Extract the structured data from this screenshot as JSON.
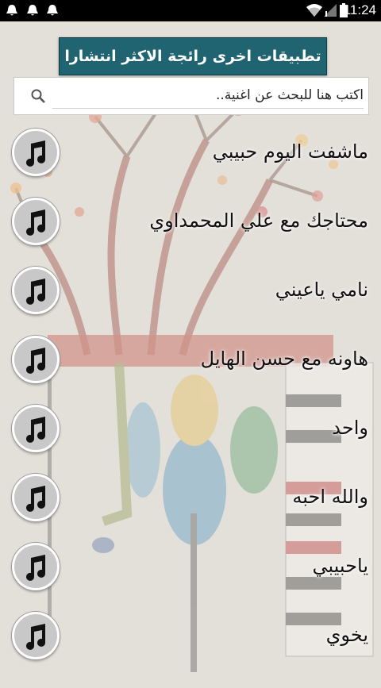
{
  "status_bar": {
    "time": "11:24",
    "notification_icons": [
      "notification-icon",
      "notification-icon",
      "notification-icon"
    ],
    "system_icons": [
      "wifi-icon",
      "signal-icon",
      "battery-icon"
    ]
  },
  "promo_button": {
    "label": "تطبيقات اخرى رائجة الاكثر انتشارا"
  },
  "search": {
    "placeholder": "اكتب هنا للبحث عن اغنية..",
    "value": ""
  },
  "songs": [
    {
      "title": "ماشفت اليوم حبيبي",
      "icon": "music-note-icon"
    },
    {
      "title": "محتاجك مع علي المحمداوي",
      "icon": "music-note-icon"
    },
    {
      "title": "نامي ياعيني",
      "icon": "music-note-icon"
    },
    {
      "title": "هاونه مع حسن الهايل",
      "icon": "music-note-icon"
    },
    {
      "title": "واحد",
      "icon": "music-note-icon"
    },
    {
      "title": "والله احبه",
      "icon": "music-note-icon"
    },
    {
      "title": "ياحبيبي",
      "icon": "music-note-icon"
    },
    {
      "title": "يخوي",
      "icon": "music-note-icon"
    }
  ],
  "colors": {
    "promo_bg": "#1f6470",
    "status_bar": "#000000"
  }
}
